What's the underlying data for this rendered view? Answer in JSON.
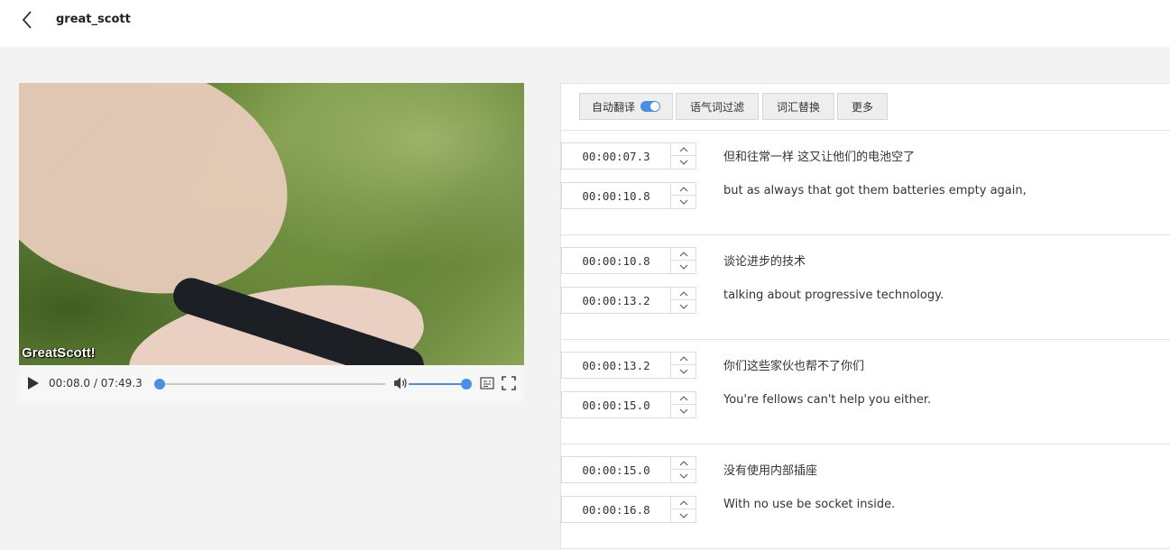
{
  "header": {
    "back_icon": "chevron-left-icon",
    "title": "great_scott"
  },
  "player": {
    "watermark": "GreatScott!",
    "time_readout": "00:08.0 / 07:49.3",
    "progress": 0.017,
    "volume": 1.0,
    "icons": [
      "play-icon",
      "volume-icon",
      "subtitle-icon",
      "fullscreen-icon"
    ]
  },
  "toolbar": {
    "auto_translate": {
      "label": "自动翻译",
      "enabled": true
    },
    "filler_filter": "语气词过滤",
    "word_replace": "词汇替换",
    "more": "更多"
  },
  "segments": [
    {
      "start": "00:00:07.3",
      "end": "00:00:10.8",
      "zh": "但和往常一样 这又让他们的电池空了",
      "en": "but as always that got them batteries empty again,"
    },
    {
      "start": "00:00:10.8",
      "end": "00:00:13.2",
      "zh": "谈论进步的技术",
      "en": "talking about progressive technology."
    },
    {
      "start": "00:00:13.2",
      "end": "00:00:15.0",
      "zh": "你们这些家伙也帮不了你们",
      "en": "You're fellows can't help you either."
    },
    {
      "start": "00:00:15.0",
      "end": "00:00:16.8",
      "zh": "没有使用内部插座",
      "en": "With no use be socket inside."
    }
  ],
  "colors": {
    "accent": "#4a90e2"
  }
}
